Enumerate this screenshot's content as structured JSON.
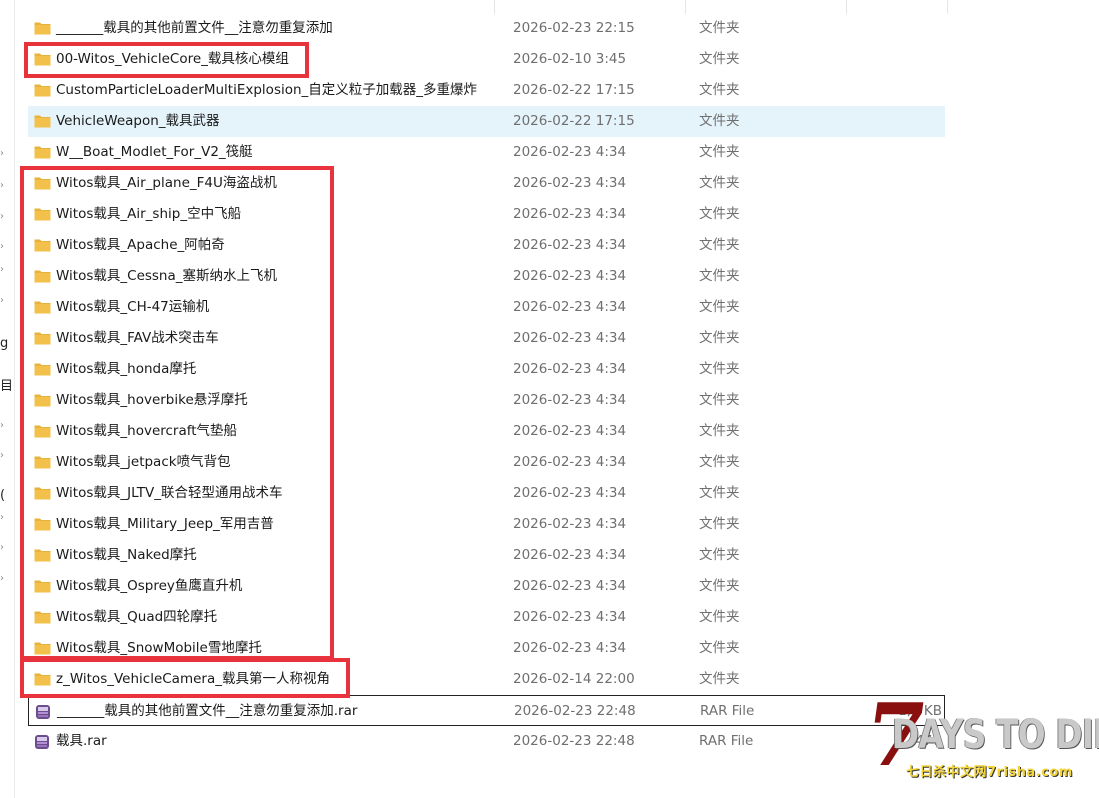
{
  "nav_fragments": [
    "g",
    "目",
    "("
  ],
  "rows": [
    {
      "name": "_______载具的其他前置文件__注意勿重复添加",
      "date": "2026-02-23 22:15",
      "type": "文件夹",
      "size": "",
      "icon": "folder-icon"
    },
    {
      "name": "00-Witos_VehicleCore_载具核心模组",
      "date": "2026-02-10 3:45",
      "type": "文件夹",
      "size": "",
      "icon": "folder-icon"
    },
    {
      "name": "CustomParticleLoaderMultiExplosion_自定义粒子加载器_多重爆炸",
      "date": "2026-02-22 17:15",
      "type": "文件夹",
      "size": "",
      "icon": "folder-icon"
    },
    {
      "name": "VehicleWeapon_载具武器",
      "date": "2026-02-22 17:15",
      "type": "文件夹",
      "size": "",
      "icon": "folder-icon"
    },
    {
      "name": "W__Boat_Modlet_For_V2_筏艇",
      "date": "2026-02-23 4:34",
      "type": "文件夹",
      "size": "",
      "icon": "folder-icon"
    },
    {
      "name": "Witos载具_Air_plane_F4U海盗战机",
      "date": "2026-02-23 4:34",
      "type": "文件夹",
      "size": "",
      "icon": "folder-icon"
    },
    {
      "name": "Witos载具_Air_ship_空中飞船",
      "date": "2026-02-23 4:34",
      "type": "文件夹",
      "size": "",
      "icon": "folder-icon"
    },
    {
      "name": "Witos载具_Apache_阿帕奇",
      "date": "2026-02-23 4:34",
      "type": "文件夹",
      "size": "",
      "icon": "folder-icon"
    },
    {
      "name": "Witos载具_Cessna_塞斯纳水上飞机",
      "date": "2026-02-23 4:34",
      "type": "文件夹",
      "size": "",
      "icon": "folder-icon"
    },
    {
      "name": "Witos载具_CH-47运输机",
      "date": "2026-02-23 4:34",
      "type": "文件夹",
      "size": "",
      "icon": "folder-icon"
    },
    {
      "name": "Witos载具_FAV战术突击车",
      "date": "2026-02-23 4:34",
      "type": "文件夹",
      "size": "",
      "icon": "folder-icon"
    },
    {
      "name": "Witos载具_honda摩托",
      "date": "2026-02-23 4:34",
      "type": "文件夹",
      "size": "",
      "icon": "folder-icon"
    },
    {
      "name": "Witos载具_hoverbike悬浮摩托",
      "date": "2026-02-23 4:34",
      "type": "文件夹",
      "size": "",
      "icon": "folder-icon"
    },
    {
      "name": "Witos载具_hovercraft气垫船",
      "date": "2026-02-23 4:34",
      "type": "文件夹",
      "size": "",
      "icon": "folder-icon"
    },
    {
      "name": "Witos载具_jetpack喷气背包",
      "date": "2026-02-23 4:34",
      "type": "文件夹",
      "size": "",
      "icon": "folder-icon"
    },
    {
      "name": "Witos载具_JLTV_联合轻型通用战术车",
      "date": "2026-02-23 4:34",
      "type": "文件夹",
      "size": "",
      "icon": "folder-icon"
    },
    {
      "name": "Witos载具_Military_Jeep_军用吉普",
      "date": "2026-02-23 4:34",
      "type": "文件夹",
      "size": "",
      "icon": "folder-icon"
    },
    {
      "name": "Witos载具_Naked摩托",
      "date": "2026-02-23 4:34",
      "type": "文件夹",
      "size": "",
      "icon": "folder-icon"
    },
    {
      "name": "Witos载具_Osprey鱼鹰直升机",
      "date": "2026-02-23 4:34",
      "type": "文件夹",
      "size": "",
      "icon": "folder-icon"
    },
    {
      "name": "Witos载具_Quad四轮摩托",
      "date": "2026-02-23 4:34",
      "type": "文件夹",
      "size": "",
      "icon": "folder-icon"
    },
    {
      "name": "Witos载具_SnowMobile雪地摩托",
      "date": "2026-02-23 4:34",
      "type": "文件夹",
      "size": "",
      "icon": "folder-icon"
    },
    {
      "name": "z_Witos_VehicleCamera_载具第一人称视角",
      "date": "2026-02-14 22:00",
      "type": "文件夹",
      "size": "",
      "icon": "folder-icon"
    },
    {
      "name": "_______载具的其他前置文件__注意勿重复添加.rar",
      "date": "2026-02-23 22:48",
      "type": "RAR File",
      "size": "1,0 KB",
      "icon": "rar-archive-icon"
    },
    {
      "name": "载具.rar",
      "date": "2026-02-23 22:48",
      "type": "RAR File",
      "size": "477",
      "icon": "rar-archive-icon"
    }
  ],
  "selected_index": 3,
  "focused_index": 22,
  "watermark": {
    "seven": "7",
    "main": "DAYS TO DIE",
    "sub": "七日杀中文网7risha.com"
  },
  "colors": {
    "folder": "#f2c04b",
    "highlight_box": "#e8323c",
    "selected_row": "#e5f3fb"
  }
}
